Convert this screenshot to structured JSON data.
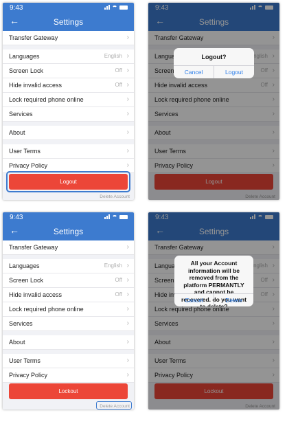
{
  "status_time": "9:43",
  "nav_title": "Settings",
  "rows": [
    {
      "label": "Transfer Gateway",
      "value": ""
    },
    {
      "label": "Languages",
      "value": "English"
    },
    {
      "label": "Screen Lock",
      "value": "Off"
    },
    {
      "label": "Hide invalid access",
      "value": "Off"
    },
    {
      "label": "Lock required phone online",
      "value": ""
    },
    {
      "label": "Services",
      "value": ""
    },
    {
      "label": "About",
      "value": ""
    },
    {
      "label": "User Terms",
      "value": ""
    },
    {
      "label": "Privacy Policy",
      "value": ""
    }
  ],
  "screens": [
    {
      "action_label": "Logout",
      "delete_label": "Delete Account"
    },
    {
      "action_label": "Logout",
      "delete_label": "Delete Account",
      "dialog": {
        "title": "Logout?",
        "cancel": "Cancel",
        "confirm": "Logout"
      }
    },
    {
      "action_label": "Lockout",
      "delete_label": "Delete Account"
    },
    {
      "action_label": "Lockout",
      "delete_label": "Delete Account",
      "dialog": {
        "title": "All your Account information will be removed from the platform PERMANTLY and cannot be recovered. do you want to delete?",
        "cancel": "Cancel",
        "confirm": "Delete"
      }
    }
  ],
  "colors": {
    "accent": "#3d7bcf",
    "danger": "#ec4638",
    "dialog_link": "#2b7de9"
  }
}
